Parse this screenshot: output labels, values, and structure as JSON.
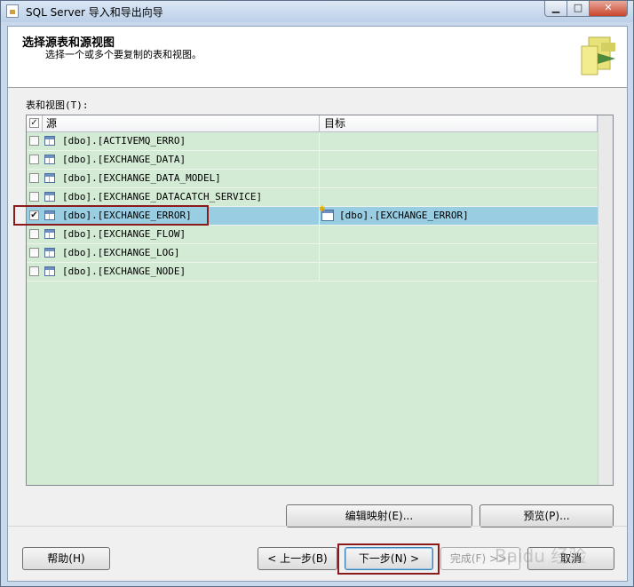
{
  "window": {
    "title": "SQL Server 导入和导出向导",
    "min_glyph": "▁",
    "max_glyph": "□",
    "close_glyph": "✕"
  },
  "header": {
    "title": "选择源表和源视图",
    "subtitle": "选择一个或多个要复制的表和视图。"
  },
  "list": {
    "label": "表和视图(T):",
    "columns": {
      "source": "源",
      "destination": "目标"
    },
    "rows": [
      {
        "source": "[dbo].[ACTIVEMQ_ERRO]",
        "destination": "",
        "checked": false,
        "selected": false
      },
      {
        "source": "[dbo].[EXCHANGE_DATA]",
        "destination": "",
        "checked": false,
        "selected": false
      },
      {
        "source": "[dbo].[EXCHANGE_DATA_MODEL]",
        "destination": "",
        "checked": false,
        "selected": false
      },
      {
        "source": "[dbo].[EXCHANGE_DATACATCH_SERVICE]",
        "destination": "",
        "checked": false,
        "selected": false
      },
      {
        "source": "[dbo].[EXCHANGE_ERROR]",
        "destination": "[dbo].[EXCHANGE_ERROR]",
        "checked": true,
        "selected": true
      },
      {
        "source": "[dbo].[EXCHANGE_FLOW]",
        "destination": "",
        "checked": false,
        "selected": false
      },
      {
        "source": "[dbo].[EXCHANGE_LOG]",
        "destination": "",
        "checked": false,
        "selected": false
      },
      {
        "source": "[dbo].[EXCHANGE_NODE]",
        "destination": "",
        "checked": false,
        "selected": false
      }
    ]
  },
  "buttons": {
    "edit_mappings": "编辑映射(E)...",
    "preview": "预览(P)...",
    "help": "帮助(H)",
    "back": "< 上一步(B)",
    "next": "下一步(N) >",
    "finish": "完成(F) >>|",
    "cancel": "取消"
  },
  "watermark": "Baidu 经验",
  "colors": {
    "grid_bg": "#d3ead4",
    "selected_row": "#99cde1",
    "highlight_border": "#8b1a1a"
  }
}
